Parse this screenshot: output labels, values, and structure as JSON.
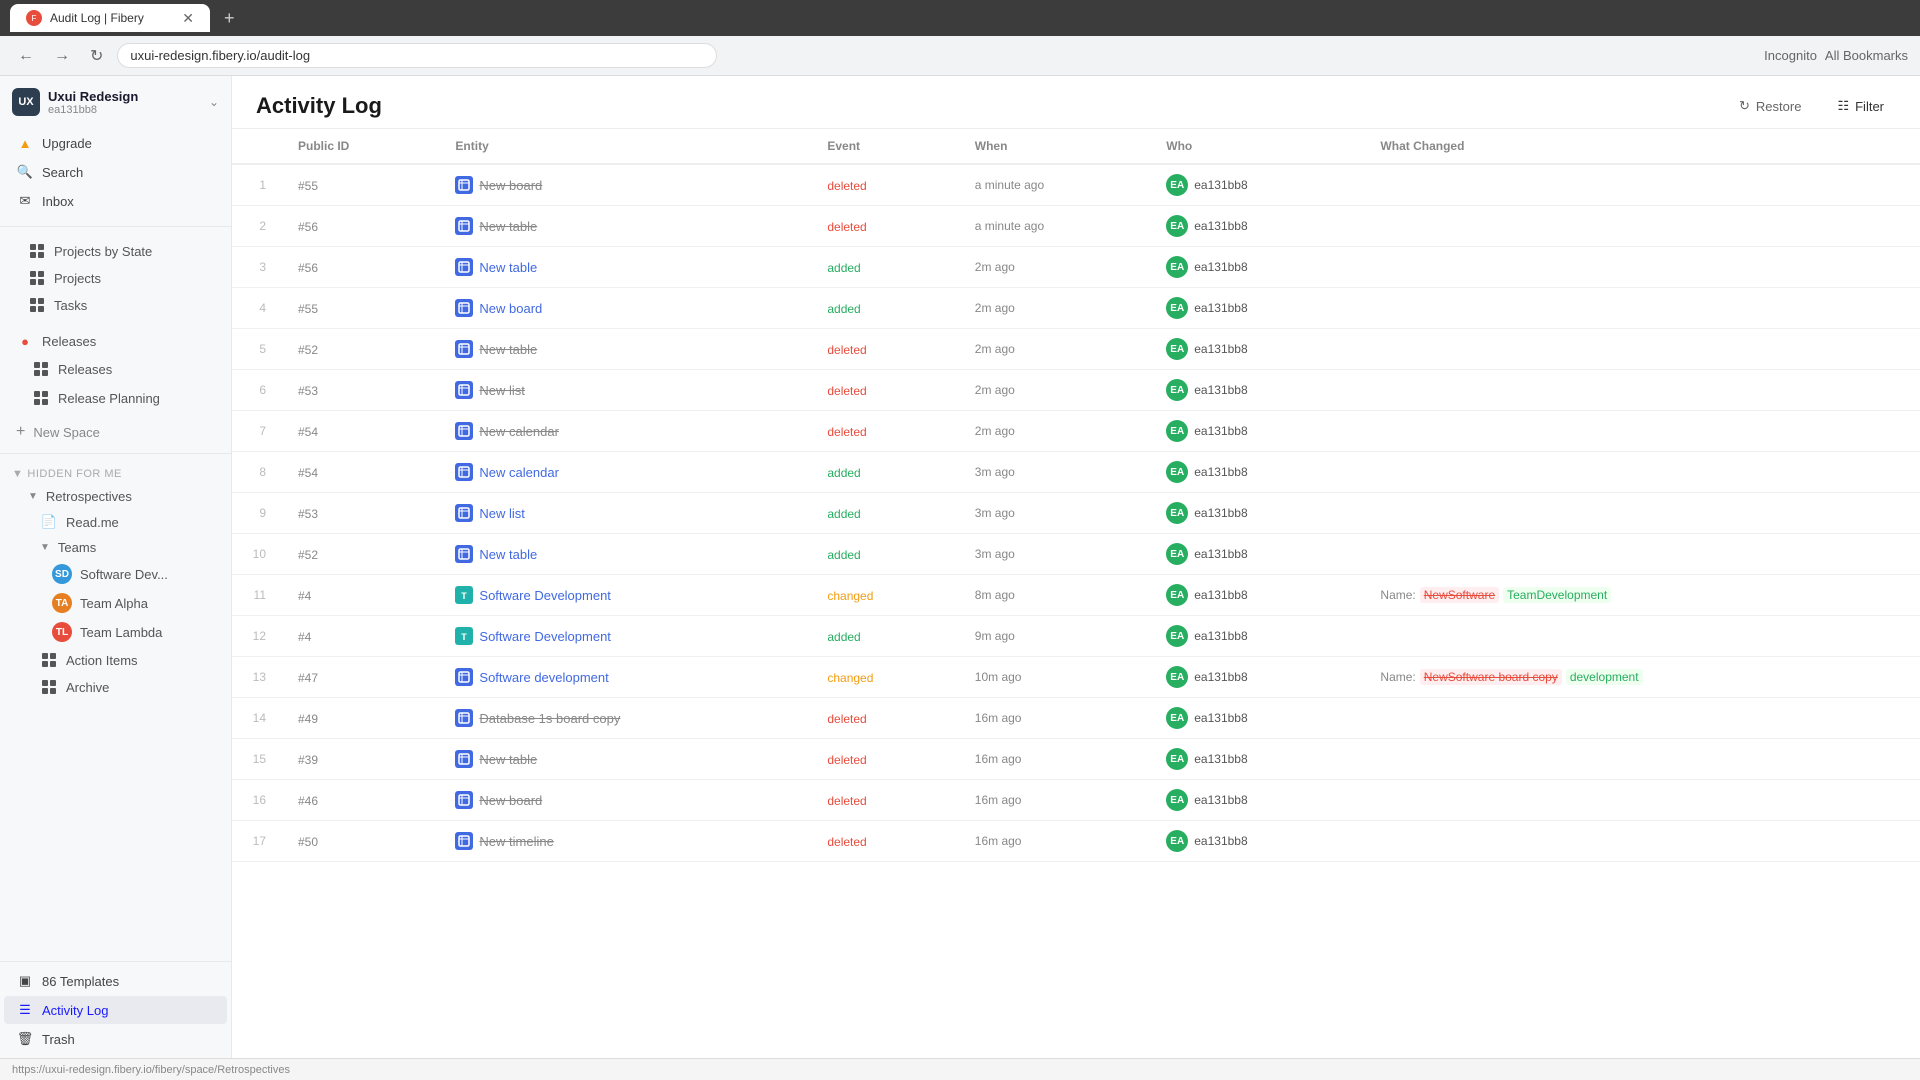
{
  "browser": {
    "tab_title": "Audit Log | Fibery",
    "url": "uxui-redesign.fibery.io/audit-log",
    "new_tab_label": "+",
    "incognito_label": "Incognito",
    "bookmarks_label": "All Bookmarks"
  },
  "sidebar": {
    "workspace": {
      "name": "Uxui Redesign",
      "sub": "ea131bb8",
      "avatar_text": "UX"
    },
    "nav_items": [
      {
        "id": "upgrade",
        "label": "Upgrade",
        "icon": "upgrade-icon"
      },
      {
        "id": "search",
        "label": "Search",
        "icon": "search-icon"
      },
      {
        "id": "inbox",
        "label": "Inbox",
        "icon": "inbox-icon"
      }
    ],
    "spaces": [
      {
        "label": "Projects by State",
        "icon": "grid-icon"
      },
      {
        "label": "Projects",
        "icon": "grid-icon"
      },
      {
        "label": "Tasks",
        "icon": "grid-icon"
      }
    ],
    "releases_section": {
      "label": "Releases",
      "icon": "releases-icon",
      "items": [
        {
          "label": "Releases",
          "icon": "grid-icon"
        },
        {
          "label": "Release Planning",
          "icon": "grid-icon"
        }
      ]
    },
    "new_space_label": "New Space",
    "hidden_for_me": {
      "section_label": "Hidden for Me",
      "items": [
        {
          "label": "Retrospectives",
          "icon": "chevron-icon",
          "children": [
            {
              "label": "Read.me",
              "icon": "doc-icon"
            },
            {
              "label": "Teams",
              "icon": "chevron-icon",
              "children": [
                {
                  "label": "Software Dev...",
                  "icon": "sd-avatar",
                  "color": "blue"
                },
                {
                  "label": "Team Alpha",
                  "icon": "ta-avatar",
                  "color": "orange"
                },
                {
                  "label": "Team Lambda",
                  "icon": "tl-avatar",
                  "color": "red"
                }
              ]
            },
            {
              "label": "Action Items",
              "icon": "grid-icon"
            },
            {
              "label": "Archive",
              "icon": "grid-icon"
            }
          ]
        }
      ]
    },
    "bottom_items": [
      {
        "id": "templates",
        "label": "86   Templates",
        "icon": "templates-icon"
      },
      {
        "id": "activity-log",
        "label": "Activity Log",
        "icon": "activity-icon",
        "active": true
      },
      {
        "id": "trash",
        "label": "Trash",
        "icon": "trash-icon"
      }
    ]
  },
  "main": {
    "page_title": "Activity Log",
    "restore_label": "Restore",
    "filter_label": "Filter",
    "table": {
      "columns": [
        "",
        "Public ID",
        "Entity",
        "Event",
        "When",
        "Who",
        "What Changed"
      ],
      "rows": [
        {
          "num": 1,
          "pub_id": "#55",
          "entity": "New board",
          "entity_type": "board",
          "event": "deleted",
          "when": "a minute ago",
          "who": "ea131bb8",
          "what_changed": ""
        },
        {
          "num": 2,
          "pub_id": "#56",
          "entity": "New table",
          "entity_type": "table",
          "event": "deleted",
          "when": "a minute ago",
          "who": "ea131bb8",
          "what_changed": ""
        },
        {
          "num": 3,
          "pub_id": "#56",
          "entity": "New table",
          "entity_type": "table",
          "event": "added",
          "when": "2m ago",
          "who": "ea131bb8",
          "what_changed": ""
        },
        {
          "num": 4,
          "pub_id": "#55",
          "entity": "New board",
          "entity_type": "board",
          "event": "added",
          "when": "2m ago",
          "who": "ea131bb8",
          "what_changed": ""
        },
        {
          "num": 5,
          "pub_id": "#52",
          "entity": "New table",
          "entity_type": "table",
          "event": "deleted",
          "when": "2m ago",
          "who": "ea131bb8",
          "what_changed": ""
        },
        {
          "num": 6,
          "pub_id": "#53",
          "entity": "New list",
          "entity_type": "list",
          "event": "deleted",
          "when": "2m ago",
          "who": "ea131bb8",
          "what_changed": ""
        },
        {
          "num": 7,
          "pub_id": "#54",
          "entity": "New calendar",
          "entity_type": "calendar",
          "event": "deleted",
          "when": "2m ago",
          "who": "ea131bb8",
          "what_changed": ""
        },
        {
          "num": 8,
          "pub_id": "#54",
          "entity": "New calendar",
          "entity_type": "calendar",
          "event": "added",
          "when": "3m ago",
          "who": "ea131bb8",
          "what_changed": ""
        },
        {
          "num": 9,
          "pub_id": "#53",
          "entity": "New list",
          "entity_type": "list",
          "event": "added",
          "when": "3m ago",
          "who": "ea131bb8",
          "what_changed": ""
        },
        {
          "num": 10,
          "pub_id": "#52",
          "entity": "New table",
          "entity_type": "table",
          "event": "added",
          "when": "3m ago",
          "who": "ea131bb8",
          "what_changed": ""
        },
        {
          "num": 11,
          "pub_id": "#4",
          "entity": "Software Development",
          "entity_type": "space",
          "event": "changed",
          "when": "8m ago",
          "who": "ea131bb8",
          "what_changed": "Name: NewSoftware TeamDevelopment"
        },
        {
          "num": 12,
          "pub_id": "#4",
          "entity": "Software Development",
          "entity_type": "space",
          "event": "added",
          "when": "9m ago",
          "who": "ea131bb8",
          "what_changed": ""
        },
        {
          "num": 13,
          "pub_id": "#47",
          "entity": "Software development",
          "entity_type": "board",
          "event": "changed",
          "when": "10m ago",
          "who": "ea131bb8",
          "what_changed": "Name: NewSoftware board copydevelopment"
        },
        {
          "num": 14,
          "pub_id": "#49",
          "entity": "Database 1s board copy",
          "entity_type": "board",
          "event": "deleted",
          "when": "16m ago",
          "who": "ea131bb8",
          "what_changed": ""
        },
        {
          "num": 15,
          "pub_id": "#39",
          "entity": "New table",
          "entity_type": "table",
          "event": "deleted",
          "when": "16m ago",
          "who": "ea131bb8",
          "what_changed": ""
        },
        {
          "num": 16,
          "pub_id": "#46",
          "entity": "New board",
          "entity_type": "board",
          "event": "deleted",
          "when": "16m ago",
          "who": "ea131bb8",
          "what_changed": ""
        },
        {
          "num": 17,
          "pub_id": "#50",
          "entity": "New timeline",
          "entity_type": "timeline",
          "event": "deleted",
          "when": "16m ago",
          "who": "ea131bb8",
          "what_changed": ""
        }
      ],
      "changed_details": {
        "11": {
          "label": "Name:",
          "old": "NewSoftware",
          "new": "TeamDevelopment"
        },
        "13": {
          "label": "Name:",
          "old": "NewSoftware board copy",
          "new": "development"
        }
      }
    }
  },
  "status_bar": {
    "url": "https://uxui-redesign.fibery.io/fibery/space/Retrospectives"
  }
}
